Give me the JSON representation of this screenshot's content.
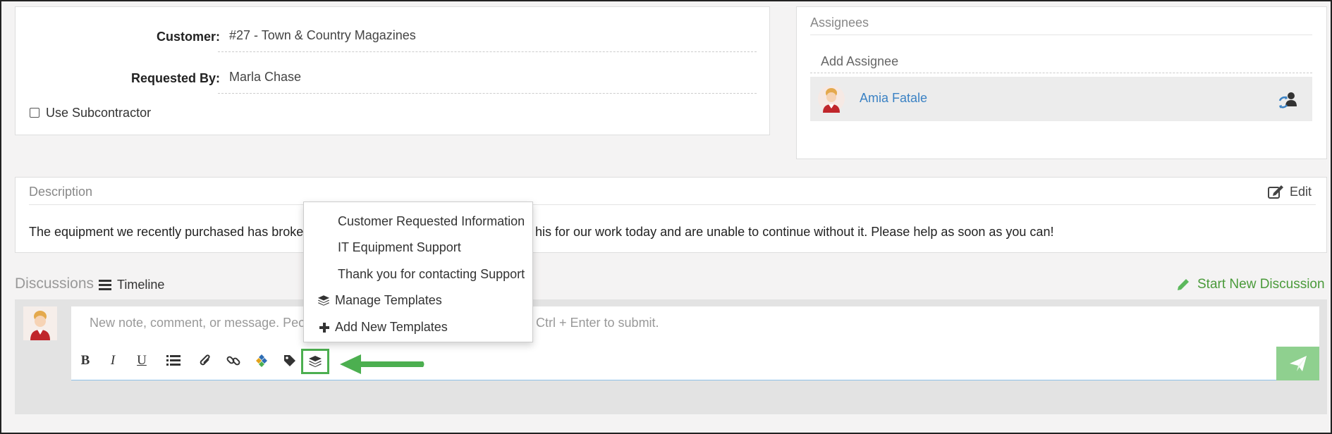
{
  "customer": {
    "label": "Customer:",
    "value": "#27 - Town & Country Magazines"
  },
  "requested_by": {
    "label": "Requested By:",
    "value": "Marla Chase"
  },
  "subcontractor": {
    "label": "Use Subcontractor",
    "checked": false
  },
  "assignees": {
    "title": "Assignees",
    "add_placeholder": "Add Assignee",
    "list": [
      {
        "name": "Amia Fatale"
      }
    ]
  },
  "description": {
    "title": "Description",
    "edit_label": "Edit",
    "text_before": "The equipment we recently purchased has broken",
    "text_after": "his for our work today and are unable to continue without it. Please help as soon as you can!"
  },
  "discussions": {
    "title": "Discussions",
    "timeline_label": "Timeline",
    "start_new_label": "Start New Discussion",
    "input_placeholder_left": "New note, comment, or message. Peopl",
    "input_placeholder_right": "Ctrl + Enter to submit."
  },
  "toolbar": {
    "bold": "B",
    "italic": "I",
    "underline": "U"
  },
  "template_menu": {
    "items": [
      "Customer Requested Information",
      "IT Equipment Support",
      "Thank you for contacting Support"
    ],
    "manage_label": "Manage Templates",
    "add_label": "Add New Templates"
  },
  "colors": {
    "accent_green": "#5cb85c",
    "link_blue": "#3b82c4",
    "send_button": "#8fd08f",
    "highlight_box": "#4caf50"
  }
}
